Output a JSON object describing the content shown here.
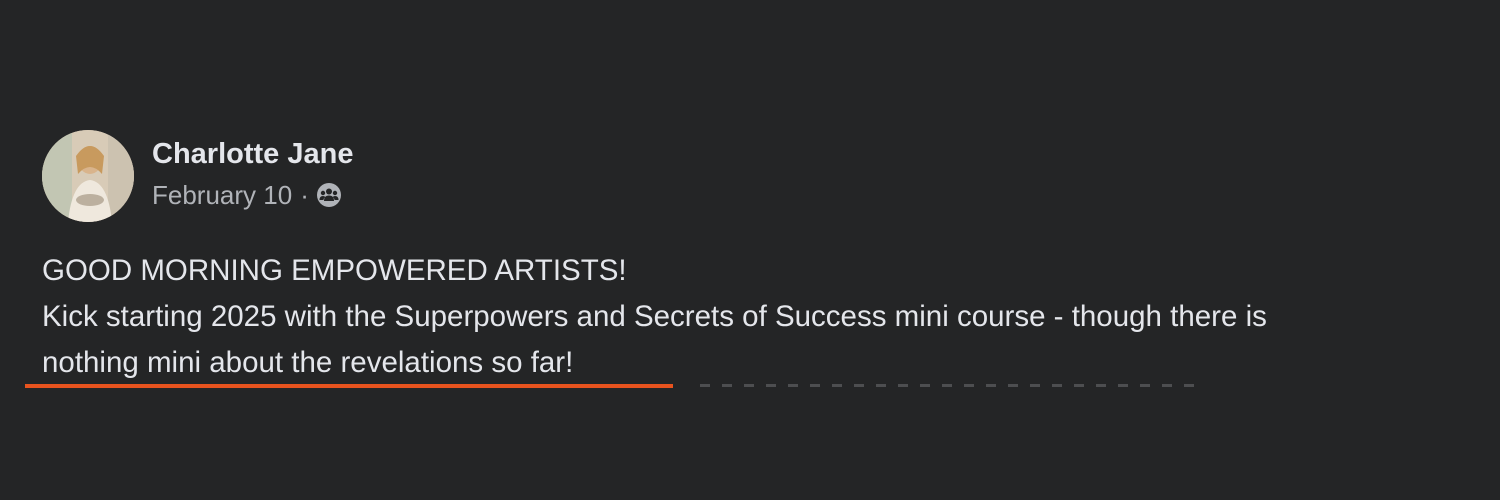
{
  "post": {
    "author": "Charlotte Jane",
    "date": "February 10",
    "separator": "·",
    "audience_icon": "group-icon",
    "lines": [
      "GOOD MORNING EMPOWERED ARTISTS!",
      "Kick starting 2025 with the Superpowers and Secrets of Success mini course - though there is",
      "nothing mini about the revelations so far!"
    ]
  },
  "colors": {
    "background": "#242526",
    "primary_text": "#e4e6eb",
    "secondary_text": "#b0b3b8",
    "highlight_underline": "#e8531e"
  }
}
